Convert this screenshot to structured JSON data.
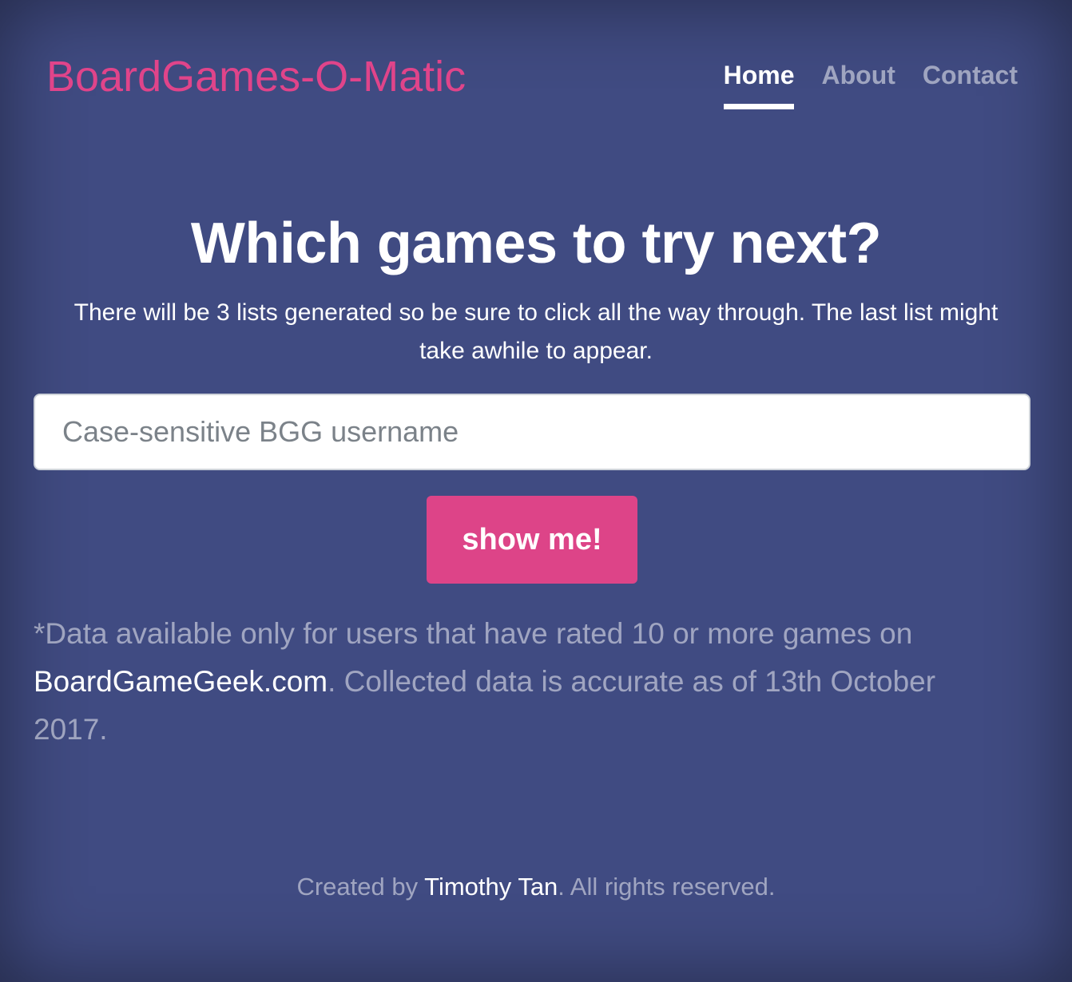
{
  "header": {
    "brand": "BoardGames-O-Matic",
    "nav": [
      {
        "label": "Home",
        "active": true
      },
      {
        "label": "About",
        "active": false
      },
      {
        "label": "Contact",
        "active": false
      }
    ]
  },
  "main": {
    "heading": "Which games to try next?",
    "lead": "There will be 3 lists generated so be sure to click all the way through. The last list might take awhile to appear.",
    "username_input": {
      "placeholder": "Case-sensitive BGG username",
      "value": ""
    },
    "submit_label": "show me!",
    "note": {
      "prefix": "*Data available only for users that have rated 10 or more games on ",
      "link": "BoardGameGeek.com",
      "suffix": ". Collected data is accurate as of 13th October 2017."
    }
  },
  "footer": {
    "prefix": "Created by ",
    "author": "Timothy Tan",
    "suffix": ". All rights reserved."
  },
  "colors": {
    "background": "#404b82",
    "accent": "#dd4488",
    "text": "#ffffff",
    "muted_text": "rgba(255,255,255,0.5)"
  }
}
